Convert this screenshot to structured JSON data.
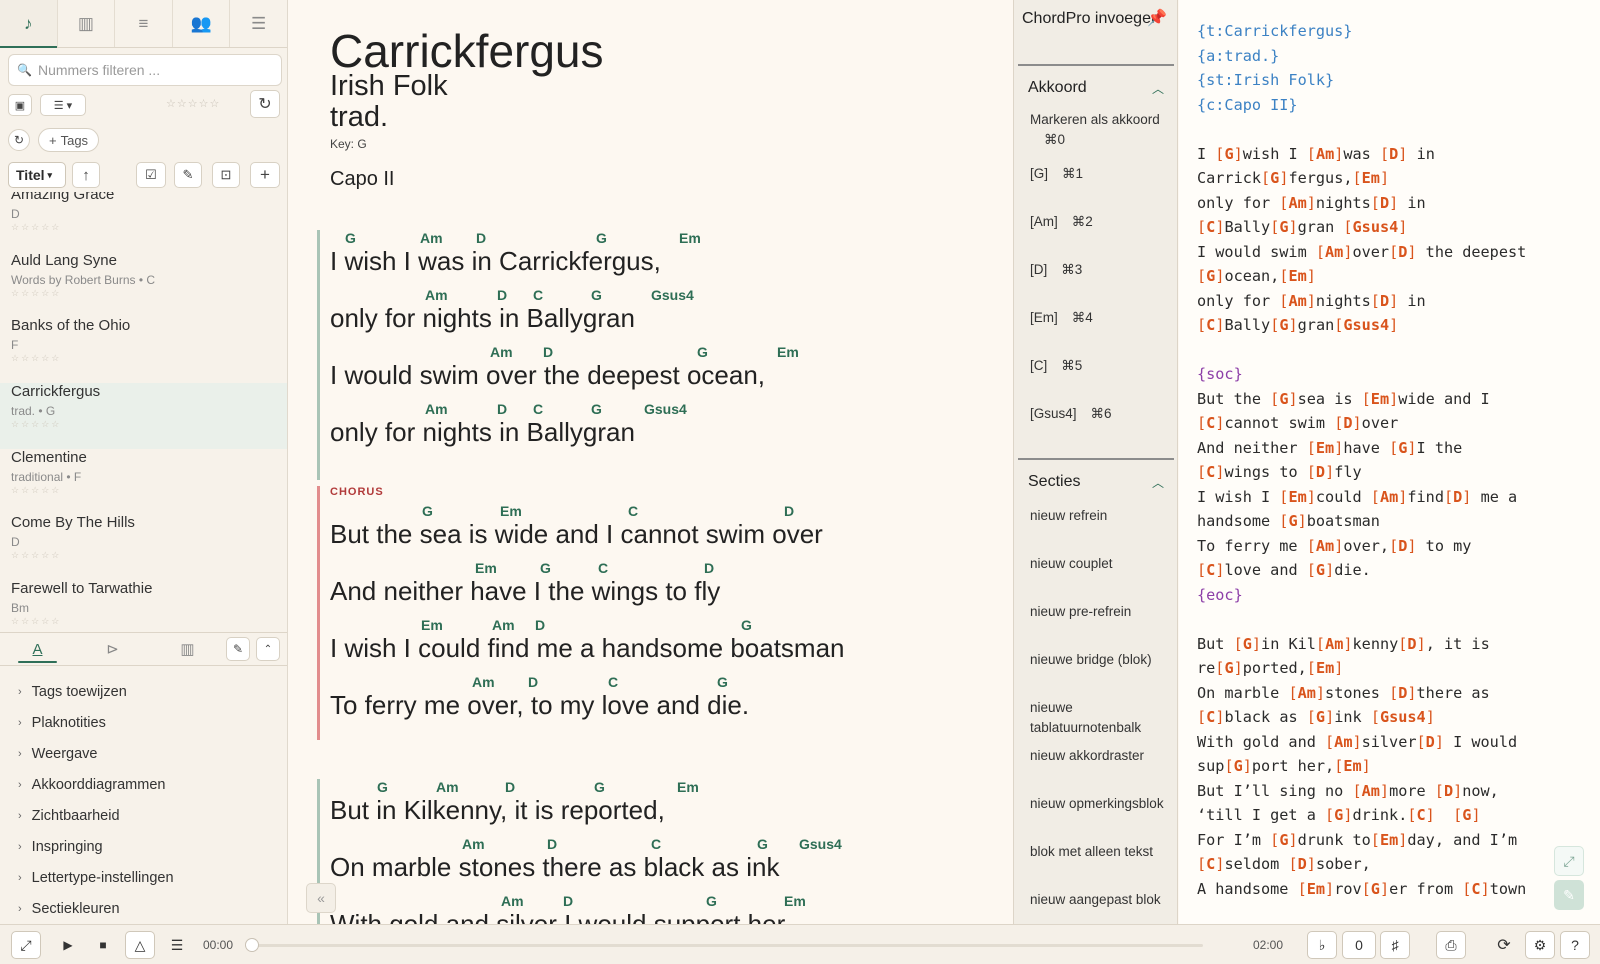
{
  "sidebar": {
    "tabs": [
      {
        "icon": "music-note-icon",
        "glyph": "♪"
      },
      {
        "icon": "keyboard-icon",
        "glyph": "▥"
      },
      {
        "icon": "playlist-icon",
        "glyph": "≡"
      },
      {
        "icon": "users-icon",
        "glyph": "👥"
      },
      {
        "icon": "sliders-icon",
        "glyph": "☰"
      }
    ],
    "search_placeholder": "Nummers filteren ...",
    "tags_label": "Tags",
    "sort_label": "Titel",
    "songs": [
      {
        "title": "Amazing Grace",
        "meta": "D",
        "stars": "☆☆☆☆☆"
      },
      {
        "title": "Auld Lang Syne",
        "meta": "Words by Robert Burns • C",
        "stars": "☆☆☆☆☆"
      },
      {
        "title": "Banks of the Ohio",
        "meta": "F",
        "stars": "☆☆☆☆☆"
      },
      {
        "title": "Carrickfergus",
        "meta": "trad. • G",
        "stars": "☆☆☆☆☆"
      },
      {
        "title": "Clementine",
        "meta": "traditional • F",
        "stars": "☆☆☆☆☆"
      },
      {
        "title": "Come By The Hills",
        "meta": "D",
        "stars": "☆☆☆☆☆"
      },
      {
        "title": "Farewell to Tarwathie",
        "meta": "Bm",
        "stars": "☆☆☆☆☆"
      }
    ],
    "settings": [
      "Tags toewijzen",
      "Plaknotities",
      "Weergave",
      "Akkoorddiagrammen",
      "Zichtbaarheid",
      "Inspringing",
      "Lettertype-instellingen",
      "Sectiekleuren"
    ]
  },
  "song": {
    "title": "Carrickfergus",
    "subtitle": "Irish Folk",
    "artist": "trad.",
    "key": "Key: G",
    "capo": "Capo II",
    "chorus_label": "CHORUS",
    "verse1": [
      {
        "lyric": "I wish I was  in Carrickfergus,",
        "chords": [
          [
            "G",
            15
          ],
          [
            "Am",
            90
          ],
          [
            "D",
            146
          ],
          [
            "G",
            266
          ],
          [
            "Em",
            349
          ]
        ]
      },
      {
        "lyric": "only for nights in Ballygran",
        "chords": [
          [
            "Am",
            95
          ],
          [
            "D",
            167
          ],
          [
            "C",
            203
          ],
          [
            "G",
            261
          ],
          [
            "Gsus4",
            321
          ]
        ]
      },
      {
        "lyric": "I would swim over the deepest ocean,",
        "chords": [
          [
            "Am",
            160
          ],
          [
            "D",
            213
          ],
          [
            "G",
            367
          ],
          [
            "Em",
            447
          ]
        ]
      },
      {
        "lyric": "only for nights in Ballygran",
        "chords": [
          [
            "Am",
            95
          ],
          [
            "D",
            167
          ],
          [
            "C",
            203
          ],
          [
            "G",
            261
          ],
          [
            "Gsus4",
            314
          ]
        ]
      }
    ],
    "chorus": [
      {
        "lyric": "But the sea is wide and I cannot swim over",
        "chords": [
          [
            "G",
            92
          ],
          [
            "Em",
            170
          ],
          [
            "C",
            298
          ],
          [
            "D",
            454
          ]
        ]
      },
      {
        "lyric": "And neither have I the wings to fly",
        "chords": [
          [
            "Em",
            145
          ],
          [
            "G",
            210
          ],
          [
            "C",
            268
          ],
          [
            "D",
            374
          ]
        ]
      },
      {
        "lyric": "I wish I could find me a handsome boatsman",
        "chords": [
          [
            "Em",
            91
          ],
          [
            "Am",
            162
          ],
          [
            "D",
            205
          ],
          [
            "G",
            411
          ]
        ]
      },
      {
        "lyric": "To ferry me over, to my love and die.",
        "chords": [
          [
            "Am",
            142
          ],
          [
            "D",
            198
          ],
          [
            "C",
            278
          ],
          [
            "G",
            387
          ]
        ]
      }
    ],
    "verse2": [
      {
        "lyric": "But in Kilkenny, it is reported,",
        "chords": [
          [
            "G",
            47
          ],
          [
            "Am",
            106
          ],
          [
            "D",
            175
          ],
          [
            "G",
            264
          ],
          [
            "Em",
            347
          ]
        ]
      },
      {
        "lyric": "On marble stones there as black as ink",
        "chords": [
          [
            "Am",
            132
          ],
          [
            "D",
            217
          ],
          [
            "C",
            321
          ],
          [
            "G",
            427
          ],
          [
            "Gsus4",
            469
          ]
        ]
      },
      {
        "lyric": "With gold and silver I would support her",
        "chords": [
          [
            "Am",
            171
          ],
          [
            "D",
            233
          ],
          [
            "G",
            376
          ],
          [
            "Em",
            454
          ]
        ]
      }
    ]
  },
  "insert_panel": {
    "title": "ChordPro invoegen",
    "chord_section": "Akkoord",
    "mark_as_chord": "Markeren als akkoord",
    "mark_shortcut": "⌘0",
    "chords": [
      {
        "label": "[G]",
        "key": "⌘1"
      },
      {
        "label": "[Am]",
        "key": "⌘2"
      },
      {
        "label": "[D]",
        "key": "⌘3"
      },
      {
        "label": "[Em]",
        "key": "⌘4"
      },
      {
        "label": "[C]",
        "key": "⌘5"
      },
      {
        "label": "[Gsus4]",
        "key": "⌘6"
      }
    ],
    "sections_title": "Secties",
    "sections": [
      "nieuw refrein",
      "nieuw couplet",
      "nieuw pre-refrein",
      "nieuwe bridge (blok)",
      "nieuwe tablatuurnotenbalk",
      "nieuw akkordraster",
      "nieuw opmerkingsblok",
      "blok met alleen tekst",
      "nieuw aangepast blok"
    ]
  },
  "editor_lines": [
    "{t:Carrickfergus}",
    "{a:trad.}",
    "{st:Irish Folk}",
    "{c:Capo II}",
    "",
    "I [G]wish I [Am]was [D] in",
    "Carrick[G]fergus,[Em]",
    "only for [Am]nights[D] in",
    "[C]Bally[G]gran [Gsus4]",
    "I would swim [Am]over[D] the deepest",
    "[G]ocean,[Em]",
    "only for [Am]nights[D] in",
    "[C]Bally[G]gran[Gsus4]",
    "",
    "{soc}",
    "But the [G]sea is [Em]wide and I",
    "[C]cannot swim [D]over",
    "And neither [Em]have [G]I the",
    "[C]wings to [D]fly",
    "I wish I [Em]could [Am]find[D] me a",
    "handsome [G]boatsman",
    "To ferry me [Am]over,[D] to my",
    "[C]love and [G]die.",
    "{eoc}",
    "",
    "But [G]in Kil[Am]kenny[D], it is",
    "re[G]ported,[Em]",
    "On marble [Am]stones [D]there as",
    "[C]black as [G]ink [Gsus4]",
    "With gold and [Am]silver[D] I would",
    "sup[G]port her,[Em]",
    "But I’ll sing no [Am]more [D]now,",
    "‘till I get a [G]drink.[C]  [G]",
    "For I’m [G]drunk to[Em]day, and I’m",
    "[C]seldom [D]sober,",
    "A handsome [Em]rov[G]er from [C]town"
  ],
  "player": {
    "time_start": "00:00",
    "time_end": "02:00",
    "transpose": "0",
    "progress": 0
  }
}
